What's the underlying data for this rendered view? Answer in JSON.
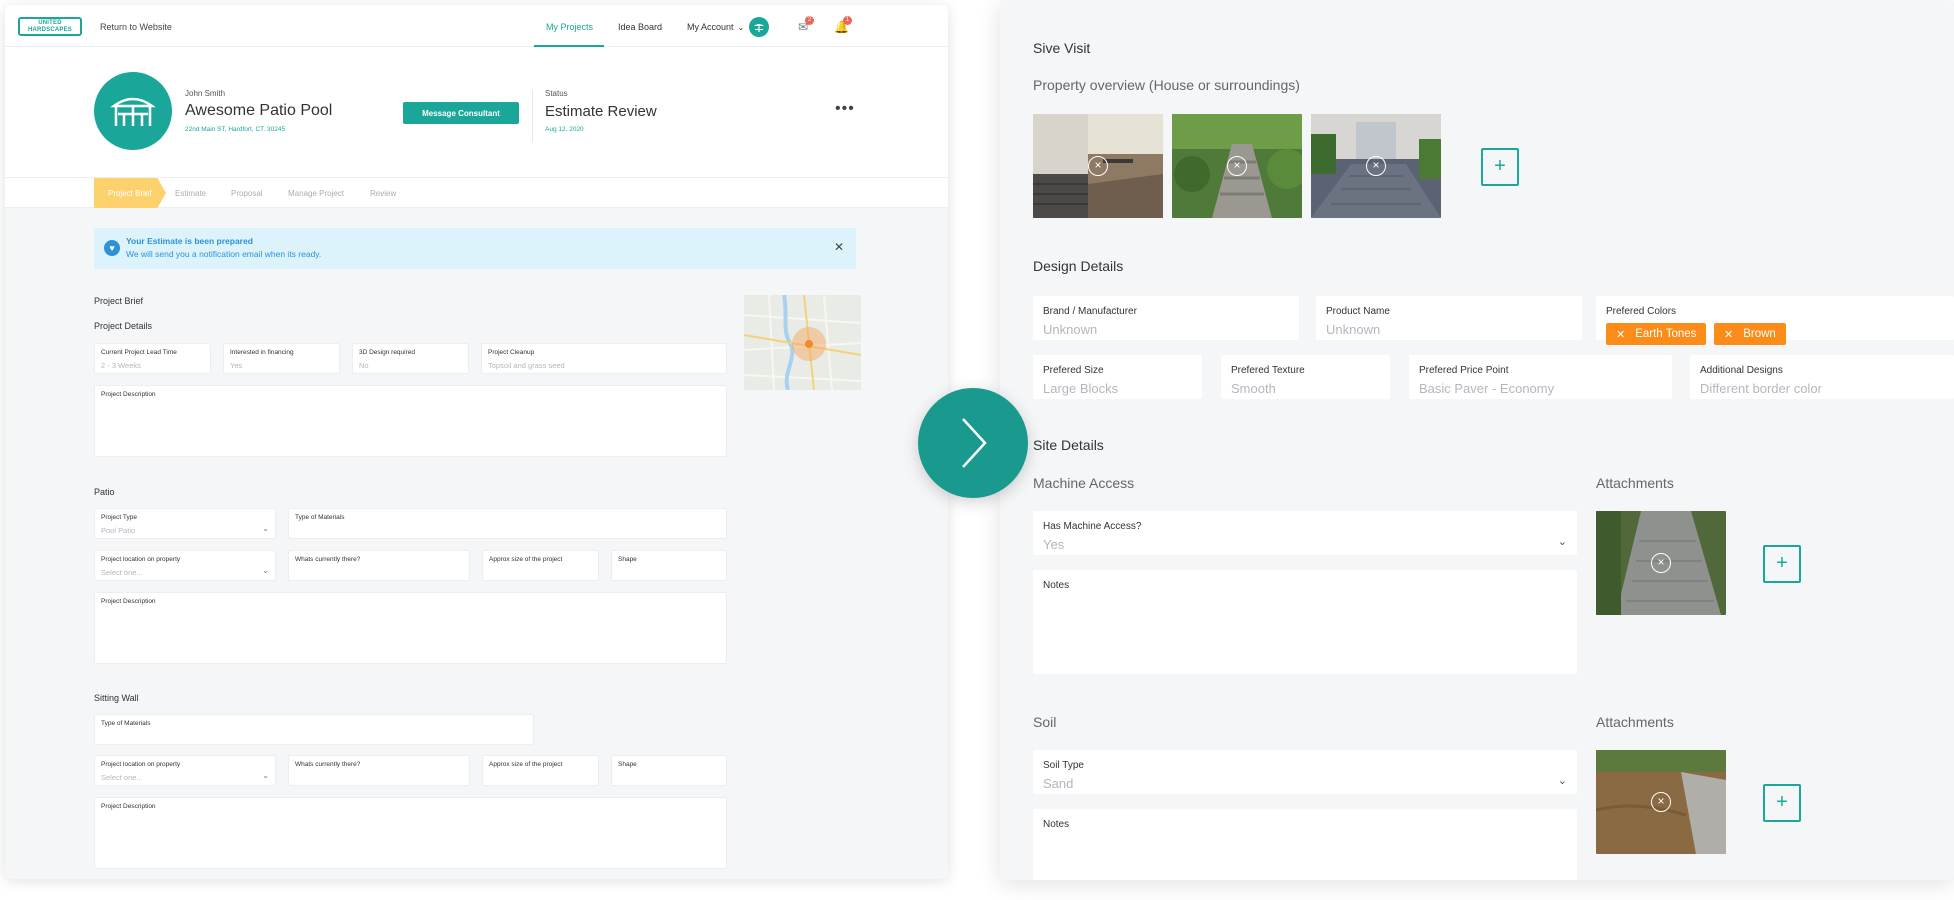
{
  "left": {
    "nav": {
      "logo": "UNITED HARDSCAPES",
      "return_link": "Return to Website",
      "items": [
        "My Projects",
        "Idea Board",
        "My Account"
      ],
      "mail_badge": "2",
      "bell_badge": "1"
    },
    "header": {
      "owner": "John Smith",
      "title": "Awesome Patio Pool",
      "address": "22nd Main ST, Hardfort, CT. 30245",
      "message_button": "Message Consultant",
      "status_label": "Status",
      "status_value": "Estimate Review",
      "status_date": "Aug 12, 2020",
      "more": "•••"
    },
    "steps": [
      "Project Brief",
      "Estimate",
      "Proposal",
      "Manage Project",
      "Review"
    ],
    "notice": {
      "title": "Your Estimate is been prepared",
      "subtitle": "We will send you a notification email when its ready."
    },
    "brief": {
      "title": "Project Brief",
      "details_title": "Project Details",
      "fields": [
        {
          "label": "Current Project Lead Time",
          "value": "2 - 3 Weeks"
        },
        {
          "label": "Interested in financing",
          "value": "Yes"
        },
        {
          "label": "3D Design required",
          "value": "No"
        },
        {
          "label": "Project Cleanup",
          "value": "Topsoil and grass seed"
        }
      ],
      "description_label": "Project Description"
    },
    "patio": {
      "title": "Patio",
      "project_type_label": "Project Type",
      "project_type_value": "Pool Patio",
      "materials_label": "Type of Materials",
      "location_label": "Project location on property",
      "location_value": "Select one...",
      "current_label": "Whats currently there?",
      "size_label": "Approx size of the project",
      "shape_label": "Shape",
      "description_label": "Project Description"
    },
    "sitting_wall": {
      "title": "Sitting Wall",
      "materials_label": "Type of Materials",
      "location_label": "Project location on property",
      "location_value": "Select one...",
      "current_label": "Whats currently there?",
      "size_label": "Approx size of the project",
      "shape_label": "Shape",
      "description_label": "Project Description"
    }
  },
  "right": {
    "site_visit_title": "Sive Visit",
    "property_overview": "Property overview (House or surroundings)",
    "design_details_title": "Design Details",
    "design": {
      "brand_label": "Brand / Manufacturer",
      "brand_value": "Unknown",
      "product_label": "Product Name",
      "product_value": "Unknown",
      "colors_label": "Prefered Colors",
      "colors": [
        "Earth Tones",
        "Brown"
      ],
      "size_label": "Prefered Size",
      "size_value": "Large Blocks",
      "texture_label": "Prefered Texture",
      "texture_value": "Smooth",
      "price_label": "Prefered Price Point",
      "price_value": "Basic Paver - Economy",
      "additional_label": "Additional Designs",
      "additional_value": "Different border color"
    },
    "site_details_title": "Site Details",
    "machine": {
      "title": "Machine Access",
      "attachments": "Attachments",
      "access_label": "Has Machine Access?",
      "access_value": "Yes",
      "notes_label": "Notes"
    },
    "soil": {
      "title": "Soil",
      "attachments": "Attachments",
      "type_label": "Soil Type",
      "type_value": "Sand",
      "notes_label": "Notes"
    }
  },
  "colors": {
    "accent": "#1aa79a",
    "chip": "#fb8c1a",
    "step_active": "#fdd26e",
    "notice": "#2d93d6"
  }
}
